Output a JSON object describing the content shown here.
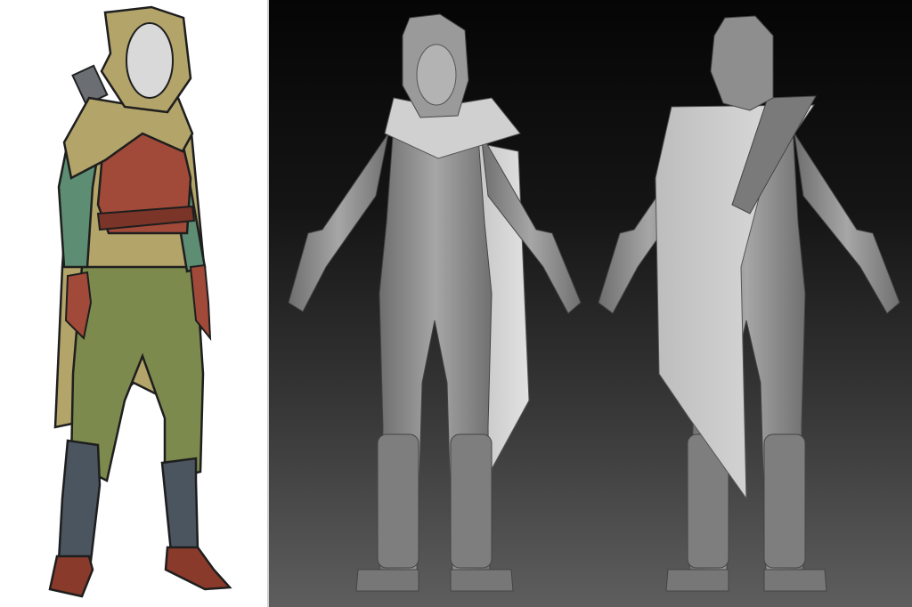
{
  "panels": [
    {
      "id": "concept",
      "kind": "color-concept-sketch"
    },
    {
      "id": "sculpt-front",
      "kind": "grey-3d-sculpt-front"
    },
    {
      "id": "sculpt-back",
      "kind": "grey-3d-sculpt-back"
    }
  ],
  "colors": {
    "cloak_olive": "#b3a46a",
    "leather_red": "#a14a39",
    "sleeve_teal": "#5d8d72",
    "trousers_green": "#7d8a4e",
    "boots_slate": "#4b5560",
    "shoes_brown": "#8a3a2a",
    "face_grey": "#d9d9d9",
    "sculpt_grey": "#8f8f8f",
    "sculpt_light": "#c9c9c9",
    "background_dark": "#0a0a0a",
    "background_floor": "#5e5e5e"
  },
  "icons": {
    "concept": "hooded-character-concept-icon",
    "front": "hooded-figure-front-icon",
    "back": "hooded-figure-back-icon"
  }
}
